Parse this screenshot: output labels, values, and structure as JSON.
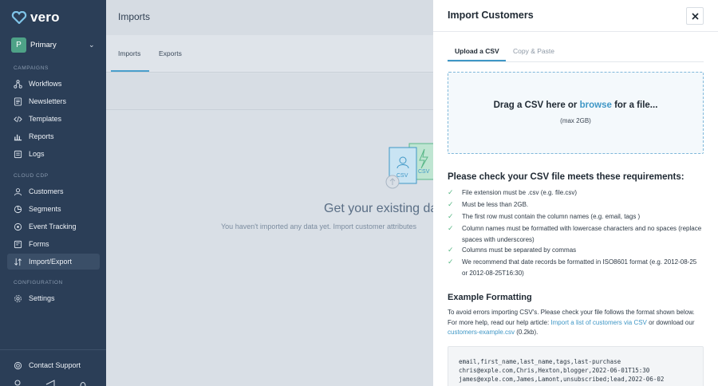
{
  "brand": {
    "name": "vero"
  },
  "account": {
    "initial": "P",
    "name": "Primary"
  },
  "sidebar": {
    "sections": {
      "campaigns": "CAMPAIGNS",
      "cloud_cdp": "CLOUD CDP",
      "configuration": "CONFIGURATION"
    },
    "items": [
      {
        "label": "Workflows",
        "icon": "workflow-icon"
      },
      {
        "label": "Newsletters",
        "icon": "newsletter-icon"
      },
      {
        "label": "Templates",
        "icon": "code-icon"
      },
      {
        "label": "Reports",
        "icon": "reports-icon"
      },
      {
        "label": "Logs",
        "icon": "logs-icon"
      },
      {
        "label": "Customers",
        "icon": "customers-icon"
      },
      {
        "label": "Segments",
        "icon": "segments-icon"
      },
      {
        "label": "Event Tracking",
        "icon": "event-icon"
      },
      {
        "label": "Forms",
        "icon": "forms-icon"
      },
      {
        "label": "Import/Export",
        "icon": "import-export-icon",
        "active": true
      },
      {
        "label": "Settings",
        "icon": "gear-icon"
      }
    ],
    "support": "Contact Support"
  },
  "main": {
    "title": "Imports",
    "tabs": [
      "Imports",
      "Exports"
    ],
    "empty_title": "Get your existing da",
    "empty_text": "You haven't imported any data yet. Import customer attributes"
  },
  "panel": {
    "title": "Import Customers",
    "tabs": [
      "Upload a CSV",
      "Copy & Paste"
    ],
    "dropzone": {
      "before": "Drag a CSV here or ",
      "browse": "browse",
      "after": " for a file...",
      "max": "(max 2GB)"
    },
    "requirements_title": "Please check your CSV file meets these requirements:",
    "requirements": [
      "File extension must be .csv (e.g. file.csv)",
      "Must be less than 2GB.",
      "The first row must contain the column names (e.g. email, tags )",
      "Column names must be formatted with lowercase characters and no spaces (replace spaces with underscores)",
      "Columns must be separated by commas",
      "We recommend that date records be formatted in ISO8601 format (e.g. 2012-08-25 or 2012-08-25T16:30)"
    ],
    "example_title": "Example Formatting",
    "example_text_1": "To avoid errors importing CSV's. Please check your file follows the format shown below. For more help, read our help article: ",
    "example_link_1": "Import a list of customers via CSV",
    "example_text_2": " or download our ",
    "example_link_2": "customers-example.csv",
    "example_text_3": " (0.2kb).",
    "code_lines": [
      "email,first_name,last_name,tags,last-purchase",
      "chris@exple.com,Chris,Hexton,blogger,2022-06-01T15:30",
      "james@exple.com,James,Lamont,unsubscribed;lead,2022-06-02"
    ]
  },
  "colors": {
    "sidebar": "#2b3e57",
    "accent": "#3f97c6",
    "check": "#59b886",
    "brand_heart": "#7fc4e8"
  }
}
